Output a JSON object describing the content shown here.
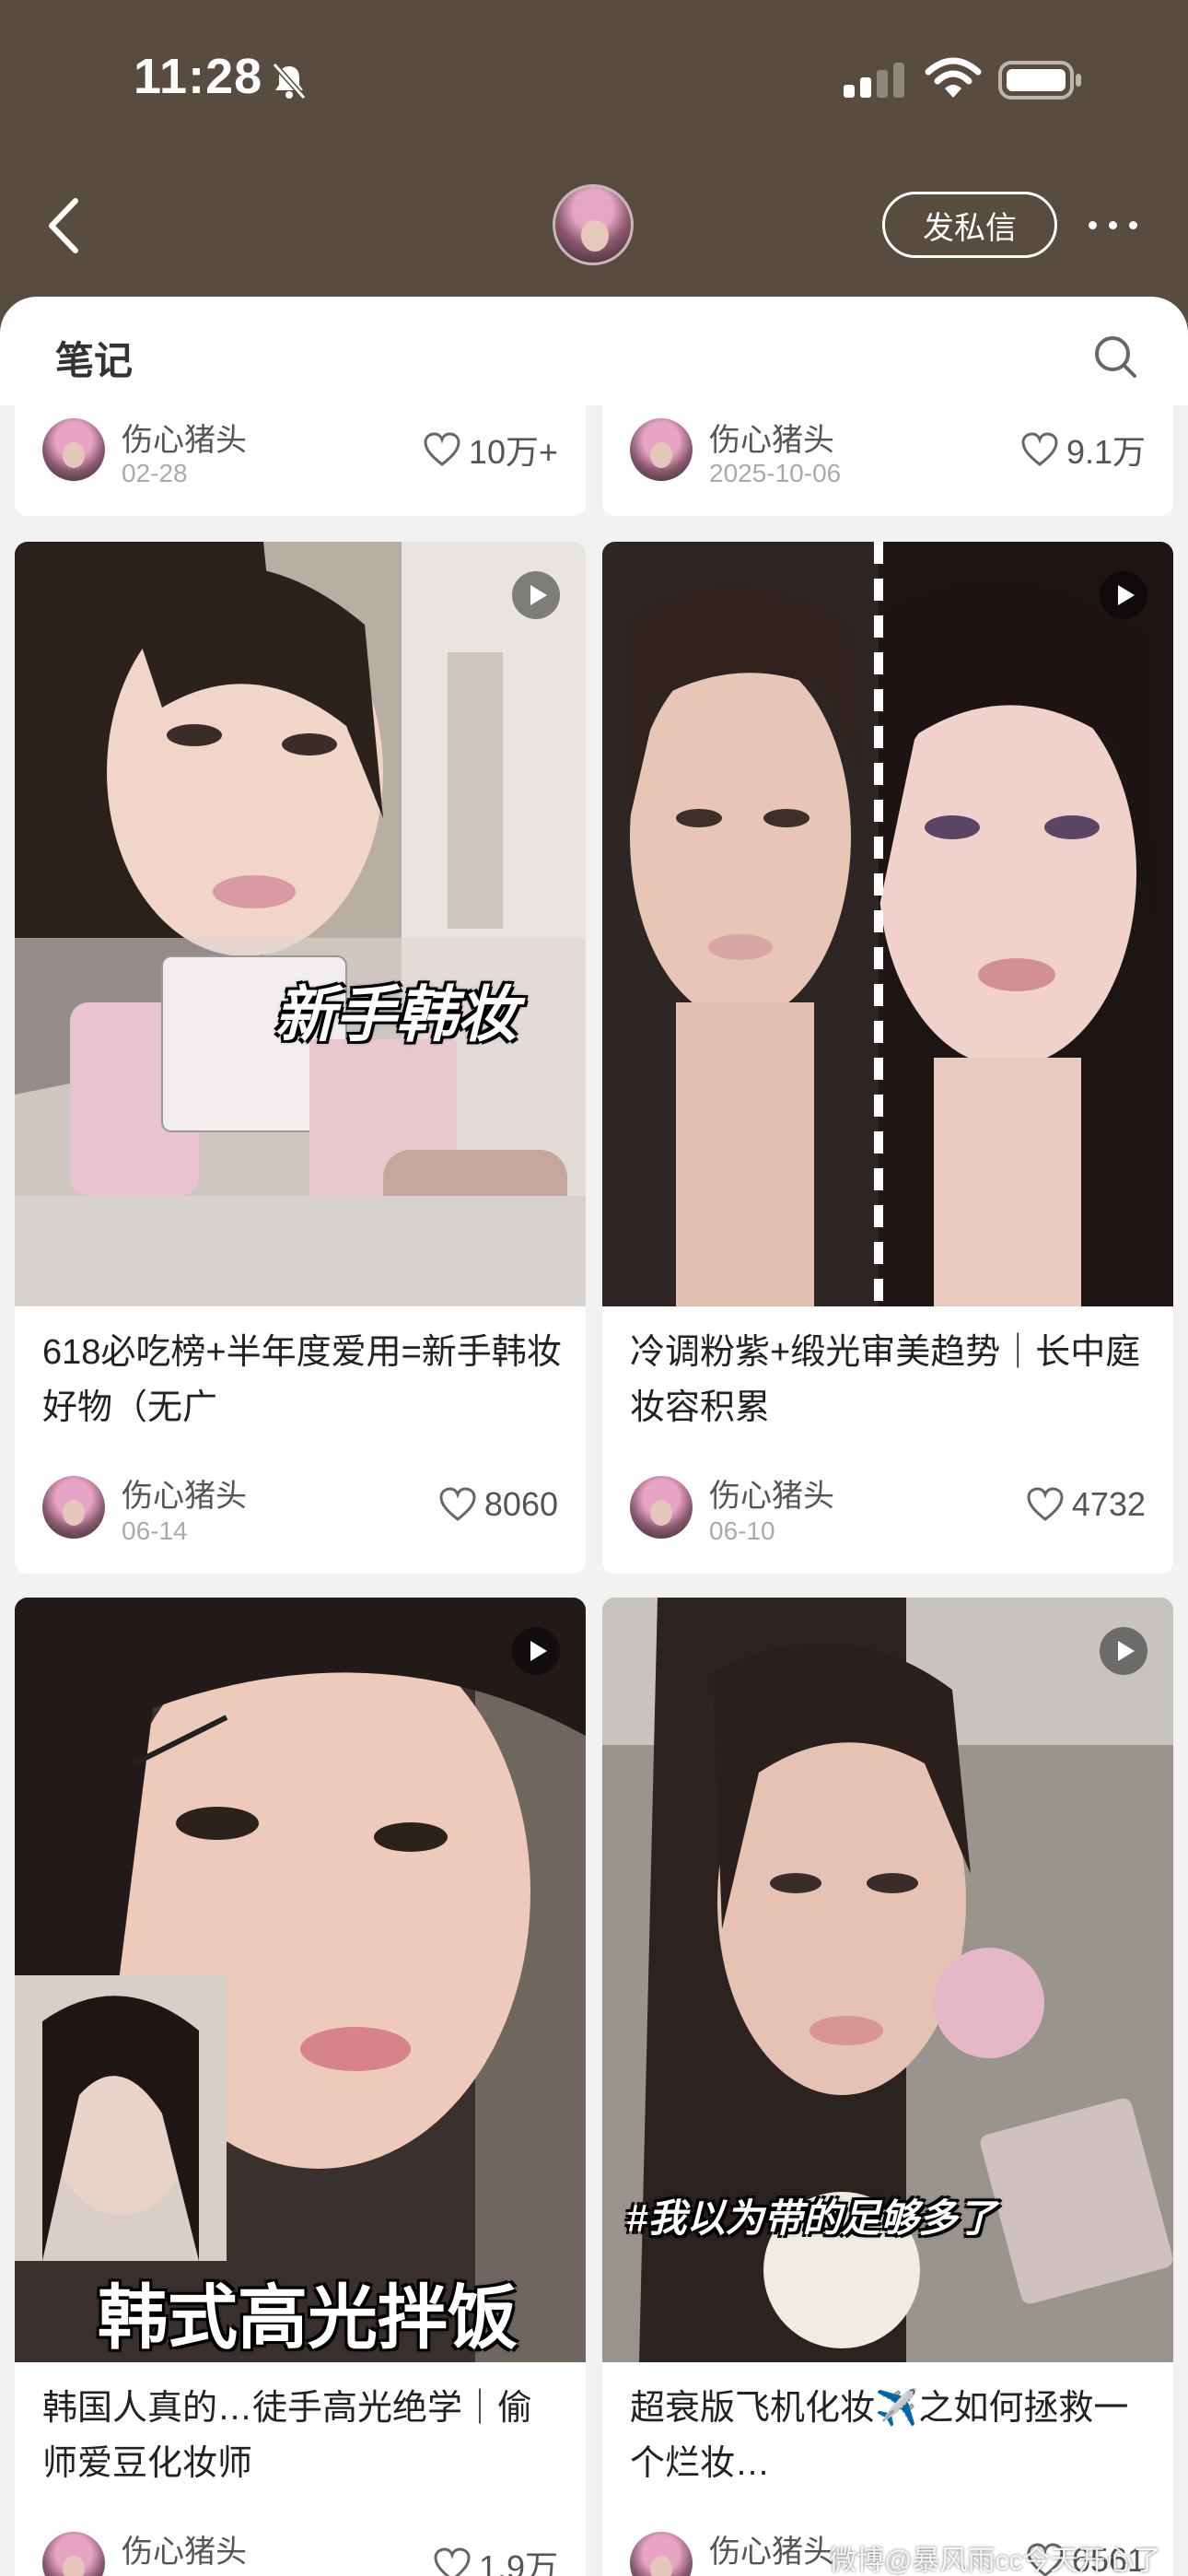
{
  "status_bar": {
    "time": "11:28",
    "icons": [
      "bell-muted-icon",
      "signal-icon",
      "wifi-icon",
      "battery-icon"
    ]
  },
  "nav": {
    "back_icon": "chevron-left-icon",
    "dm_label": "发私信",
    "more_icon": "more-dots-icon"
  },
  "section": {
    "title": "笔记",
    "search_icon": "search-icon"
  },
  "cards": [
    {
      "author": "伤心猪头",
      "date": "02-28",
      "likes": "10万+"
    },
    {
      "author": "伤心猪头",
      "date": "2025-10-06",
      "likes": "9.1万"
    },
    {
      "title": "618必吃榜+半年度爱用=新手韩妆好物（无广",
      "overlay": "新手韩妆",
      "author": "伤心猪头",
      "date": "06-14",
      "likes": "8060",
      "is_video": true
    },
    {
      "title": "冷调粉紫+缎光审美趋势｜长中庭妆容积累",
      "overlay": "",
      "author": "伤心猪头",
      "date": "06-10",
      "likes": "4732",
      "is_video": true
    },
    {
      "title": "韩国人真的…徒手高光绝学｜偷师爱豆化妆师",
      "overlay": "韩式高光拌饭",
      "author": "伤心猪头",
      "date": "",
      "likes": "1.9万",
      "is_video": true
    },
    {
      "title": "超衰版飞机化妆✈️之如何拯救一个烂妆…",
      "overlay": "#我以为带的足够多了",
      "author": "伤心猪头",
      "date": "",
      "likes": "6561",
      "is_video": true
    }
  ],
  "watermark": "微博@暴风雨cc今天开心了吗",
  "colors": {
    "header_bg": "#574c3f",
    "sheet_bg": "#f2f2f2",
    "card_bg": "#ffffff",
    "text_primary": "#222222",
    "text_secondary": "#aaaaaa"
  }
}
